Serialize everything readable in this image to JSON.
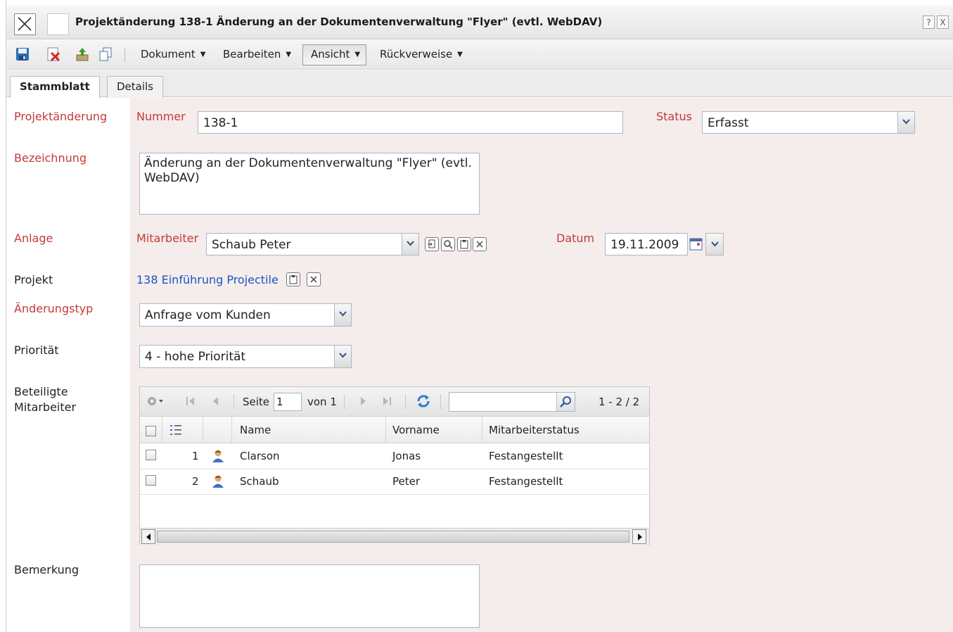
{
  "window": {
    "title": "Projektänderung 138-1 Änderung an der Dokumentenverwaltung \"Flyer\" (evtl. WebDAV)",
    "help_label": "?",
    "close_label": "X"
  },
  "toolbar": {
    "icons": [
      "save-icon",
      "delete-icon",
      "upload-icon",
      "copy-icon"
    ],
    "menus": [
      {
        "label": "Dokument"
      },
      {
        "label": "Bearbeiten"
      },
      {
        "label": "Ansicht"
      },
      {
        "label": "Rückverweise"
      }
    ]
  },
  "tabs": [
    {
      "label": "Stammblatt",
      "active": true
    },
    {
      "label": "Details",
      "active": false
    }
  ],
  "form": {
    "section_projektaenderung": "Projektänderung",
    "nummer_label": "Nummer",
    "nummer_value": "138-1",
    "status_label": "Status",
    "status_value": "Erfasst",
    "bezeichnung_label": "Bezeichnung",
    "bezeichnung_value": "Änderung  an der Dokumentenverwaltung \"Flyer\" (evtl. WebDAV)",
    "anlage_label": "Anlage",
    "mitarbeiter_label": "Mitarbeiter",
    "mitarbeiter_value": "Schaub Peter",
    "datum_label": "Datum",
    "datum_value": "19.11.2009",
    "projekt_label": "Projekt",
    "projekt_value": "138 Einführung Projectile",
    "aenderungstyp_label": "Änderungstyp",
    "aenderungstyp_value": "Anfrage vom Kunden",
    "prioritaet_label": "Priorität",
    "prioritaet_value": "4 - hohe Priorität",
    "beteiligte_label_1": "Beteiligte",
    "beteiligte_label_2": "Mitarbeiter",
    "bemerkung_label": "Bemerkung",
    "bemerkung_value": ""
  },
  "grid": {
    "page_label": "Seite",
    "page_value": "1",
    "of_label": "von 1",
    "count_label": "1 - 2 / 2",
    "search_value": "",
    "columns": [
      "Name",
      "Vorname",
      "Mitarbeiterstatus"
    ],
    "rows": [
      {
        "nr": "1",
        "name": "Clarson",
        "vorname": "Jonas",
        "status": "Festangestellt"
      },
      {
        "nr": "2",
        "name": "Schaub",
        "vorname": "Peter",
        "status": "Festangestellt"
      }
    ]
  },
  "colors": {
    "required_label": "#c23a3a",
    "link": "#1a55c4",
    "field_band": "#f5ecec"
  }
}
